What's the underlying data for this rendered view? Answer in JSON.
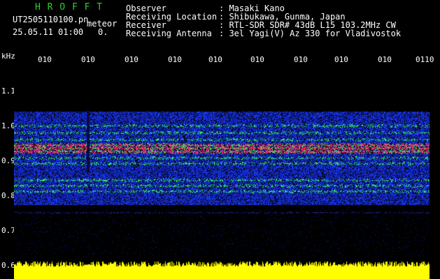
{
  "header": {
    "app_name": "H R O F F T",
    "filename": "UT2505110100.pn",
    "event_label": "meteor",
    "datetime": "25.05.11 01:00",
    "count": "0.",
    "fields": [
      {
        "label": "Observer",
        "value": ": Masaki Kano"
      },
      {
        "label": "Receiving Location",
        "value": ": Shibukawa, Gunma, Japan"
      },
      {
        "label": "Receiver",
        "value": ": RTL-SDR SDR# 43dB L15 103.2MHz CW"
      },
      {
        "label": "Receiving Antenna",
        "value": ": 3el Yagi(V) Az 330 for Vladivostok"
      }
    ]
  },
  "y_axis": {
    "unit": "kHz",
    "ticks": [
      "1.1",
      "1.0",
      "0.9",
      "0.8",
      "0.7",
      "0.6"
    ]
  },
  "x_axis": {
    "ticks": [
      "010",
      "010",
      "010",
      "010",
      "010",
      "010",
      "010",
      "010",
      "010",
      "0110"
    ]
  },
  "colors": {
    "background": "#000000",
    "text": "#ffffff",
    "title_green": "#2ad42a",
    "signal_strong": "#ff2a6a",
    "signal_mid": "#33ff66",
    "noise_blue": "#1e3cff",
    "floor_yellow": "#ffff00"
  }
}
